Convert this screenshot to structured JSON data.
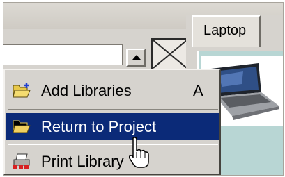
{
  "tabs": [
    {
      "label": "Laptop"
    }
  ],
  "context_menu": {
    "items": [
      {
        "label": "Add Libraries",
        "shortcut": "A",
        "icon": "folder-add-icon"
      },
      {
        "label": "Return to Project",
        "icon": "folder-open-icon",
        "highlighted": true
      },
      {
        "label": "Print Library",
        "icon": "printer-icon"
      }
    ]
  },
  "icons": {
    "scroll_up": "arrow-up-icon",
    "placeholder": "image-placeholder-icon",
    "laptop_thumbnail": "laptop-image-icon",
    "cursor": "mouse-pointer-icon"
  },
  "colors": {
    "menu_bg": "#d6d3ce",
    "highlight": "#0b2a78",
    "thumbnail_bg": "#b8d6d4"
  }
}
